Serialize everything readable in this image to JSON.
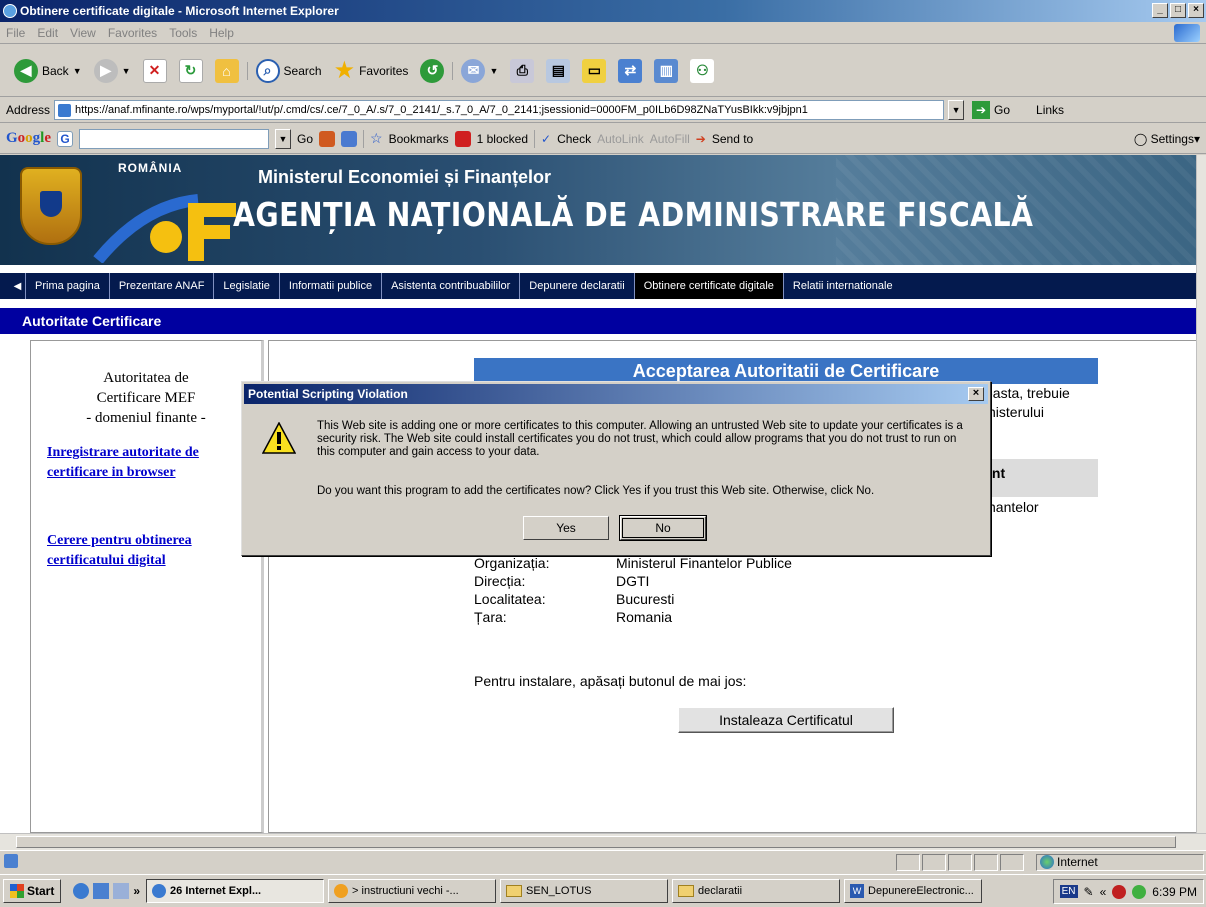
{
  "window": {
    "title": "Obtinere certificate digitale - Microsoft Internet Explorer",
    "controls": [
      "_",
      "□",
      "×"
    ]
  },
  "menu": [
    "File",
    "Edit",
    "View",
    "Favorites",
    "Tools",
    "Help"
  ],
  "toolbar": {
    "back": "Back",
    "search": "Search",
    "favorites": "Favorites"
  },
  "address": {
    "label": "Address",
    "url": "https://anaf.mfinante.ro/wps/myportal/!ut/p/.cmd/cs/.ce/7_0_A/.s/7_0_2141/_s.7_0_A/7_0_2141;jsessionid=0000FM_p0ILb6D98ZNaTYusBIkk:v9jbjpn1",
    "go": "Go",
    "links": "Links"
  },
  "googlebar": {
    "logo": [
      "G",
      "o",
      "o",
      "g",
      "l",
      "e"
    ],
    "go": "Go",
    "bookmarks": "Bookmarks",
    "blocked": "1 blocked",
    "check": "Check",
    "autolink": "AutoLink",
    "autofill": "AutoFill",
    "sendto": "Send to",
    "settings": "Settings"
  },
  "banner": {
    "romania": "ROMÂNIA",
    "ministry": "Ministerul Economiei și Finanțelor",
    "agency": "AGENȚIA NAȚIONALĂ DE ADMINISTRARE FISCALĂ"
  },
  "nav": [
    {
      "label": "Prima pagina",
      "active": false
    },
    {
      "label": "Prezentare ANAF",
      "active": false
    },
    {
      "label": "Legislatie",
      "active": false
    },
    {
      "label": "Informatii publice",
      "active": false
    },
    {
      "label": "Asistenta contribuabililor",
      "active": false
    },
    {
      "label": "Depunere declaratii",
      "active": false
    },
    {
      "label": "Obtinere certificate digitale",
      "active": true
    },
    {
      "label": "Relatii internationale",
      "active": false
    }
  ],
  "section_title": "Autoritate Certificare",
  "left": {
    "title_lines": [
      "Autoritatea de",
      "Certificare MEF",
      "- domeniul finante -"
    ],
    "link1": "Inregistrare autoritate de certificare in browser",
    "link2": "Cerere pentru obtinerea certificatului digital"
  },
  "content": {
    "header": "Acceptarea Autoritatii de Certificare",
    "partial1": "easta, trebuie",
    "partial2": "nisterului",
    "partial3": "int",
    "partial4": "nantelor",
    "details": [
      {
        "label": "Organizația:",
        "value": "Ministerul Finantelor Publice"
      },
      {
        "label": "Direcția:",
        "value": "DGTI"
      },
      {
        "label": "Localitatea:",
        "value": "Bucuresti"
      },
      {
        "label": "Țara:",
        "value": "Romania"
      }
    ],
    "install_prompt": "Pentru instalare, apăsați butonul de mai jos:",
    "install_button": "Instaleaza Certificatul"
  },
  "dialog": {
    "title": "Potential Scripting Violation",
    "close": "×",
    "message": "This Web site is adding one or more certificates to this computer. Allowing an untrusted Web site to update your certificates is a security risk. The Web site could install certificates you do not trust, which could allow programs that you do not trust to run on this computer and gain access to your data.",
    "question": "Do you want this program to add the certificates now? Click Yes if you trust this Web site. Otherwise, click No.",
    "yes": "Yes",
    "no": "No"
  },
  "status": {
    "zone": "Internet"
  },
  "taskbar": {
    "start": "Start",
    "tasks": [
      "26 Internet Expl...",
      "> instructiuni vechi -...",
      "SEN_LOTUS",
      "declaratii",
      "DepunereElectronic..."
    ],
    "lang": "EN",
    "time": "6:39 PM"
  },
  "colors": {
    "nav_bg": "#041a4e",
    "section_bar": "#0000a0",
    "content_header": "#3a74c4",
    "link": "#0000cc"
  }
}
